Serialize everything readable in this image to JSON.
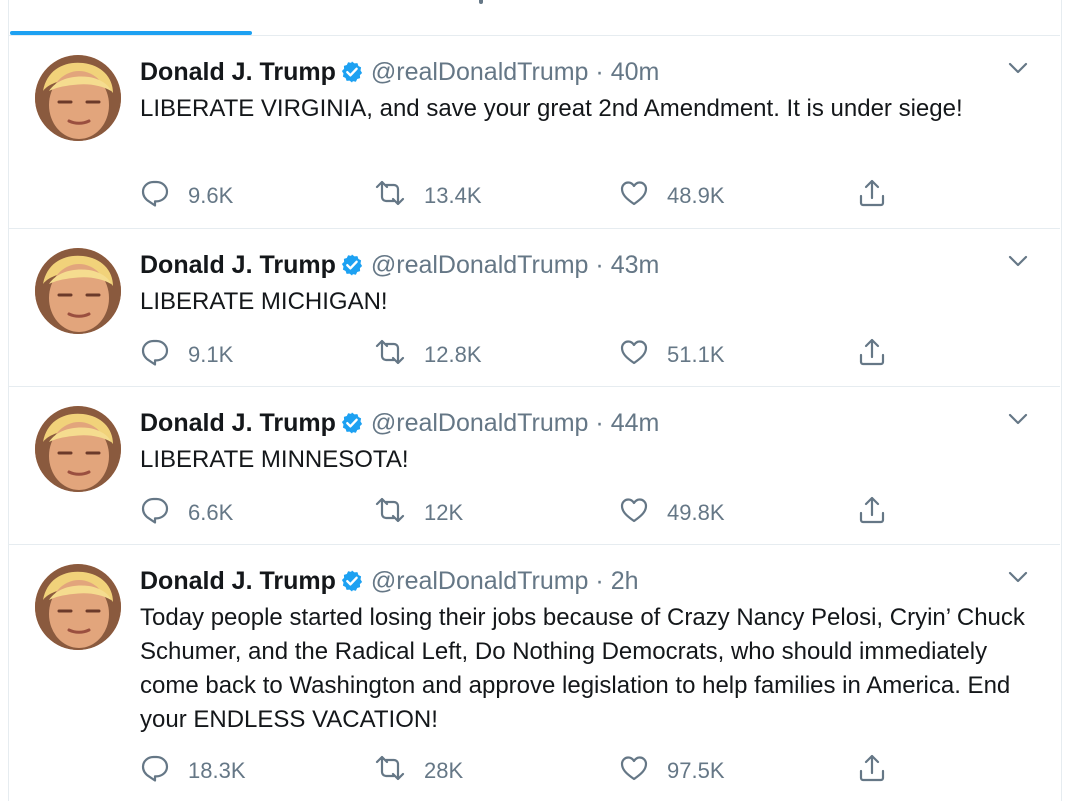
{
  "tweets": [
    {
      "name": "Donald J. Trump",
      "handle": "@realDonaldTrump",
      "separator": "·",
      "time": "40m",
      "text": "LIBERATE VIRGINIA, and save your great 2nd Amendment. It is under siege!",
      "replies": "9.6K",
      "retweets": "13.4K",
      "likes": "48.9K"
    },
    {
      "name": "Donald J. Trump",
      "handle": "@realDonaldTrump",
      "separator": "·",
      "time": "43m",
      "text": "LIBERATE MICHIGAN!",
      "replies": "9.1K",
      "retweets": "12.8K",
      "likes": "51.1K"
    },
    {
      "name": "Donald J. Trump",
      "handle": "@realDonaldTrump",
      "separator": "·",
      "time": "44m",
      "text": "LIBERATE MINNESOTA!",
      "replies": "6.6K",
      "retweets": "12K",
      "likes": "49.8K"
    },
    {
      "name": "Donald J. Trump",
      "handle": "@realDonaldTrump",
      "separator": "·",
      "time": "2h",
      "text": "Today people started losing their jobs because of Crazy Nancy Pelosi, Cryin’ Chuck Schumer, and the Radical Left, Do Nothing Democrats, who should immediately come back to Washington and approve legislation to help families in America. End your ENDLESS VACATION!",
      "replies": "18.3K",
      "retweets": "28K",
      "likes": "97.5K"
    }
  ],
  "colors": {
    "accent": "#1da1f2",
    "secondary_text": "#657786",
    "border": "#e6ecf0"
  },
  "icons": [
    "verified-badge-icon",
    "chevron-down-icon",
    "reply-icon",
    "retweet-icon",
    "like-icon",
    "share-icon"
  ]
}
